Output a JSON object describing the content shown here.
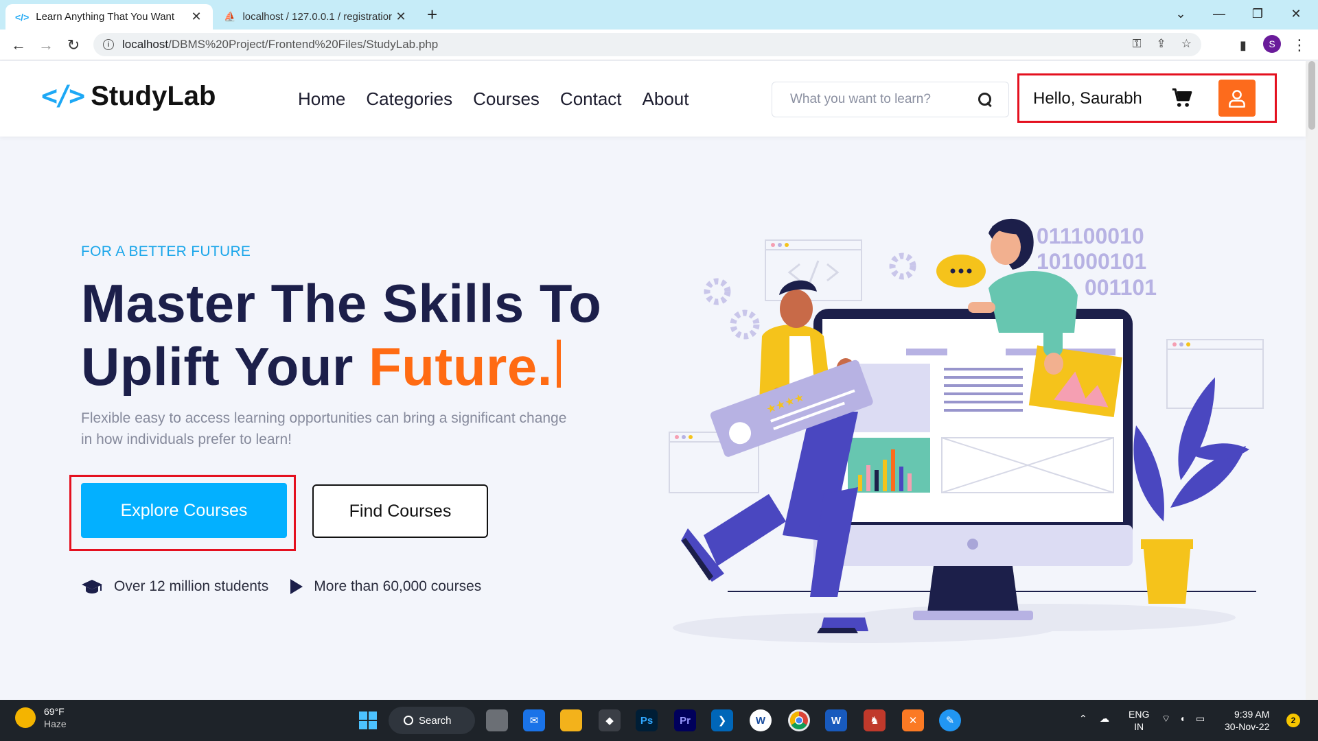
{
  "browser": {
    "tabs": [
      {
        "title": "Learn Anything That You Want"
      },
      {
        "title": "localhost / 127.0.0.1 / registratior"
      }
    ],
    "url_host": "localhost",
    "url_path": "/DBMS%20Project/Frontend%20Files/StudyLab.php",
    "profile_initial": "S"
  },
  "site": {
    "logo_mark": "</>",
    "logo_name": "StudyLab",
    "nav": [
      "Home",
      "Categories",
      "Courses",
      "Contact",
      "About"
    ],
    "search_placeholder": "What you want to learn?",
    "greeting": "Hello, Saurabh"
  },
  "hero": {
    "eyebrow": "FOR A BETTER FUTURE",
    "headline_line1": "Master The Skills To",
    "headline_line2_start": "Uplift Your ",
    "headline_accent": "Future.",
    "lead": "Flexible easy to access learning opportunities can bring a significant change in how individuals prefer to learn!",
    "primary_cta": "Explore Courses",
    "secondary_cta": "Find Courses",
    "stat_students": "Over 12 million students",
    "stat_courses": "More than 60,000 courses",
    "binary_lines": [
      "011100010",
      "101000101",
      "001101"
    ]
  },
  "taskbar": {
    "temperature": "69°F",
    "condition": "Haze",
    "search_label": "Search",
    "language": "ENG",
    "region": "IN",
    "time": "9:39 AM",
    "date": "30-Nov-22",
    "notification_count": "2"
  },
  "colors": {
    "brand_blue": "#03b0ff",
    "accent_orange": "#ff6b13",
    "heading_navy": "#1c1f4a",
    "highlight_red": "#e4101f"
  }
}
